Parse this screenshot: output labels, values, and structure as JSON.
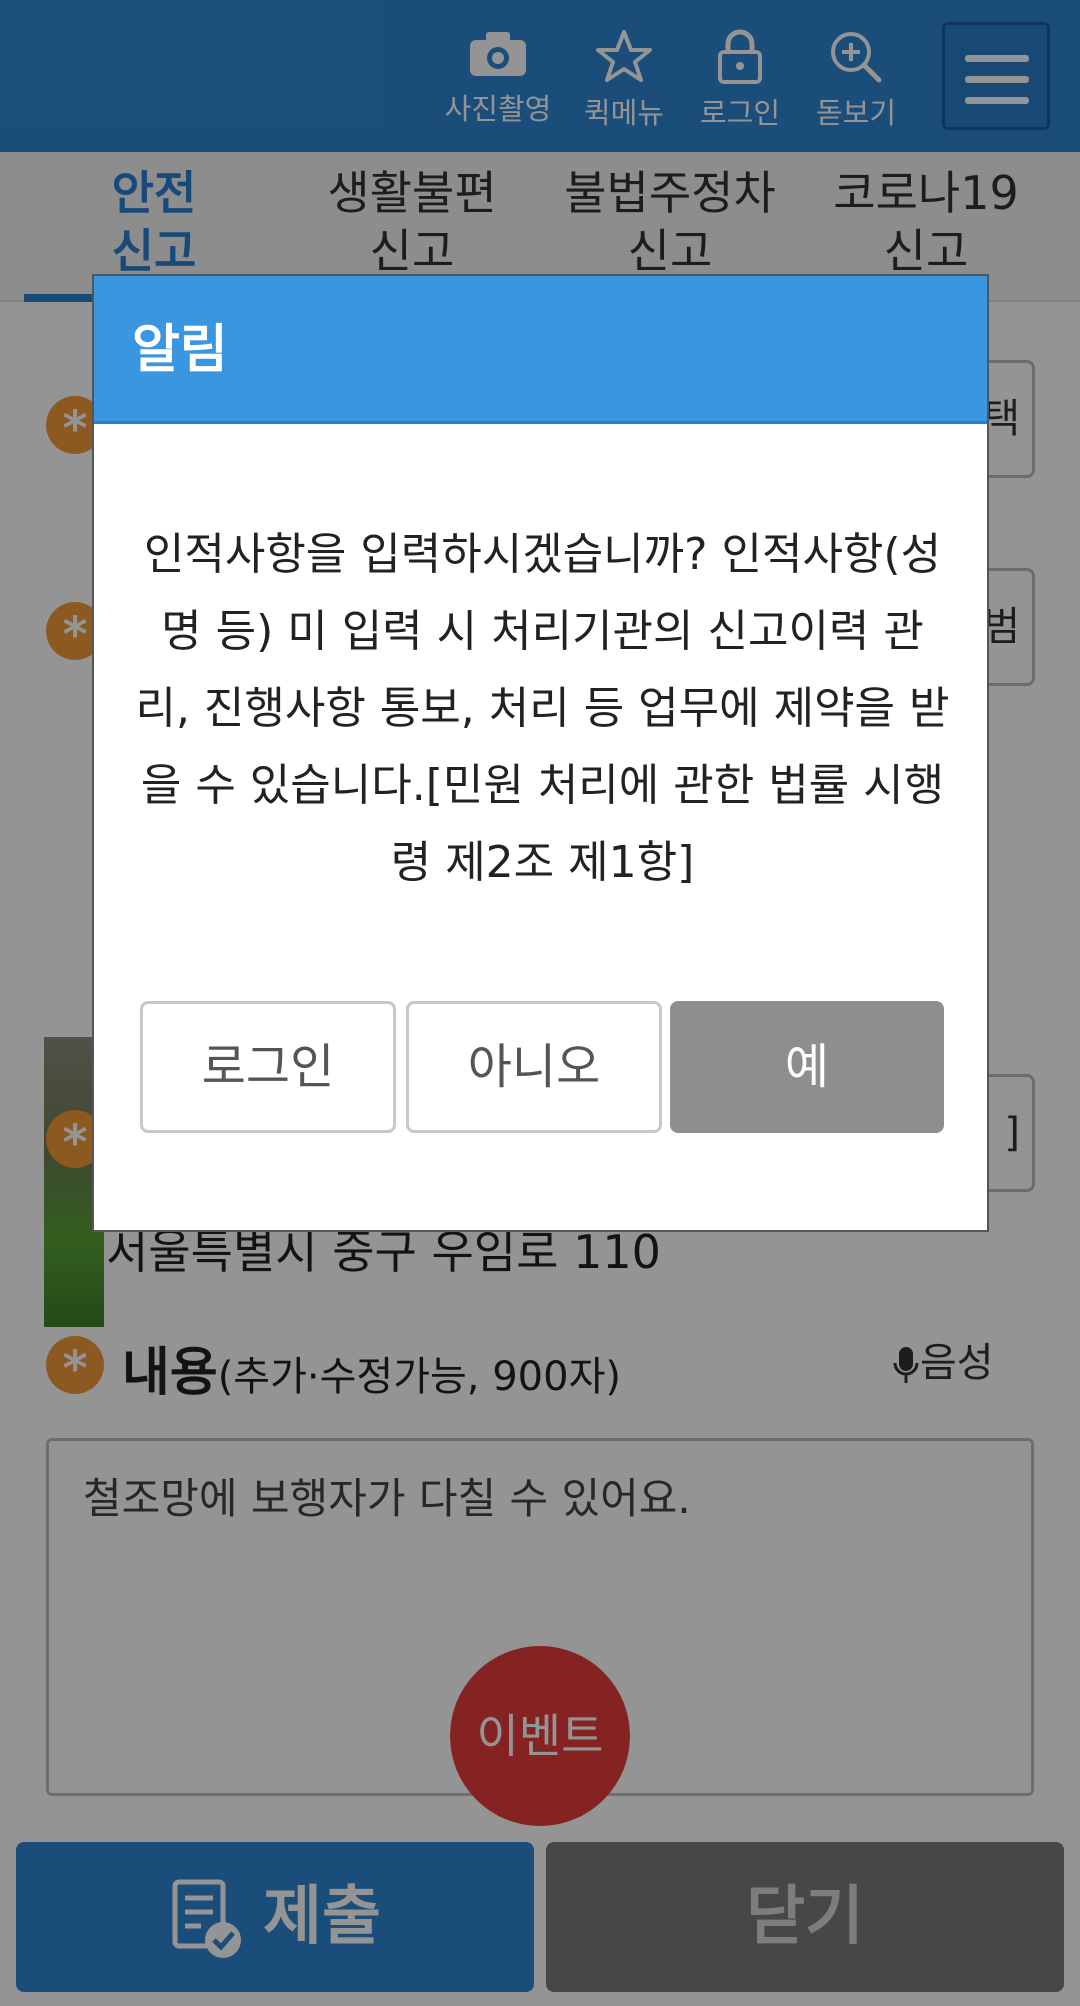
{
  "header": {
    "buttons": [
      {
        "label": "사진촬영",
        "icon": "camera-icon"
      },
      {
        "label": "퀵메뉴",
        "icon": "star-icon"
      },
      {
        "label": "로그인",
        "icon": "lock-icon"
      },
      {
        "label": "돋보기",
        "icon": "magnifier-icon"
      }
    ],
    "menu_icon": "hamburger-menu-icon"
  },
  "tabs": [
    {
      "label": "안전\n신고",
      "active": true
    },
    {
      "label": "생활불편\n신고",
      "active": false
    },
    {
      "label": "불법주정차\n신고",
      "active": false
    },
    {
      "label": "코로나19\n신고",
      "active": false
    }
  ],
  "form": {
    "required_mark": "*",
    "side_button_1": "택",
    "side_button_2": "범",
    "side_button_3": "]",
    "address": "서울특별시 중구 우임로 110",
    "content_label": "내용",
    "content_hint": "(추가·수정가능, 900자)",
    "voice_label": "음성",
    "content_value": "철조망에 보행자가 다칠 수 있어요."
  },
  "event_button": "이벤트",
  "footer": {
    "submit_label": "제출",
    "close_label": "닫기"
  },
  "dialog": {
    "title": "알림",
    "message": "인적사항을 입력하시겠습니까? 인적사항(성명 등) 미 입력 시 처리기관의 신고이력 관리, 진행사항 통보, 처리 등 업무에 제약을 받을 수 있습니다.[민원 처리에 관한 법률 시행령 제2조 제1항]",
    "buttons": {
      "login": "로그인",
      "no": "아니오",
      "yes": "예"
    }
  },
  "colors": {
    "brand_blue": "#2f86d4",
    "dialog_header": "#3b96e0",
    "required_orange": "#f29a3a",
    "event_red": "#e53c3c"
  }
}
